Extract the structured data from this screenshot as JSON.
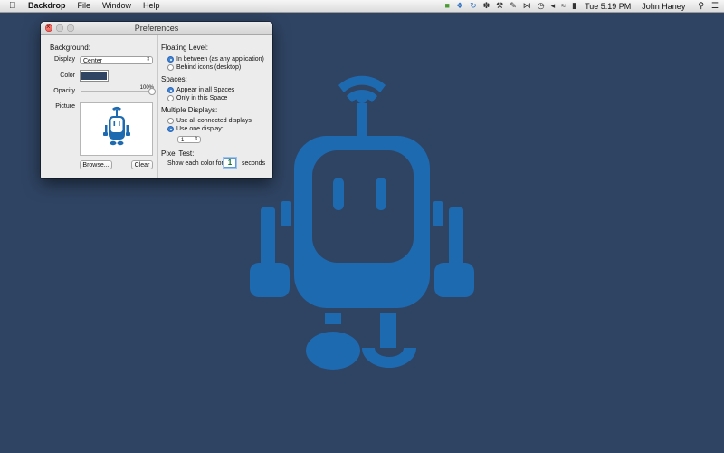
{
  "menubar": {
    "app_name": "Backdrop",
    "items": [
      "File",
      "Window",
      "Help"
    ],
    "clock": "Tue 5:19 PM",
    "user": "John Haney",
    "tray_icons": [
      "evernote-icon",
      "dropbox-icon",
      "sync-icon",
      "paw-icon",
      "wrench-icon",
      "note-icon",
      "bluetooth-icon",
      "history-icon",
      "volume-icon",
      "wifi-icon",
      "battery-icon"
    ]
  },
  "window": {
    "title": "Preferences",
    "background": {
      "heading": "Background:",
      "display_label": "Display",
      "display_value": "Center",
      "color_label": "Color",
      "color_value": "#2f4463",
      "opacity_label": "Opacity",
      "opacity_value_text": "100%",
      "opacity_value": 1.0,
      "picture_label": "Picture",
      "browse_button": "Browse...",
      "clear_button": "Clear"
    },
    "floating_level": {
      "heading": "Floating Level:",
      "options": [
        "In between (as any application)",
        "Behind icons (desktop)"
      ],
      "selected": 0
    },
    "spaces": {
      "heading": "Spaces:",
      "options": [
        "Appear in all Spaces",
        "Only in this Space"
      ],
      "selected": 0
    },
    "multiple_displays": {
      "heading": "Multiple Displays:",
      "options": [
        "Use all connected displays",
        "Use one display:"
      ],
      "selected": 1,
      "display_number": "1"
    },
    "pixel_test": {
      "heading": "Pixel Test:",
      "prefix": "Show each color for",
      "value": "1",
      "suffix": "seconds"
    }
  },
  "colors": {
    "desktop": "#2f4463",
    "robot": "#1e6ab0"
  }
}
